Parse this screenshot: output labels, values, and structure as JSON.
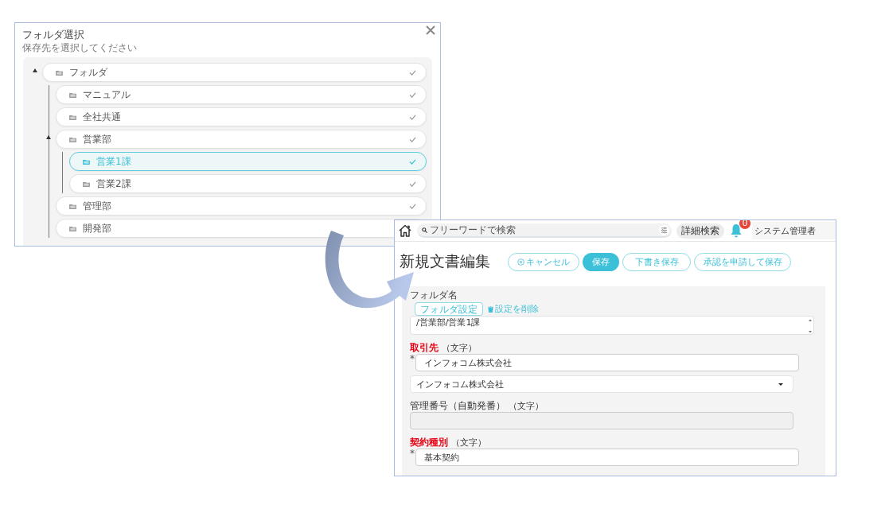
{
  "folder_dialog": {
    "title": "フォルダ選択",
    "subtitle": "保存先を選択してください",
    "tree": [
      {
        "label": "フォルダ",
        "selected": false,
        "children": [
          {
            "label": "マニュアル",
            "selected": false
          },
          {
            "label": "全社共通",
            "selected": false
          },
          {
            "label": "営業部",
            "selected": false,
            "children": [
              {
                "label": "営業1課",
                "selected": true
              },
              {
                "label": "営業2課",
                "selected": false
              }
            ]
          },
          {
            "label": "管理部",
            "selected": false
          },
          {
            "label": "開発部",
            "selected": false
          }
        ]
      }
    ]
  },
  "editor": {
    "header": {
      "search_placeholder": "フリーワードで検索",
      "advanced_search": "詳細検索",
      "notification_count": "0",
      "user": "システム管理者"
    },
    "title": "新規文書編集",
    "buttons": [
      {
        "label": "キャンセル",
        "kind": "cancel"
      },
      {
        "label": "保存",
        "kind": "primary"
      },
      {
        "label": "下書き保存",
        "kind": "outline"
      },
      {
        "label": "承認を申請して保存",
        "kind": "outline"
      }
    ],
    "folder": {
      "label": "フォルダ名",
      "set_button": "フォルダ設定",
      "clear_link": "設定を削除",
      "path": "/営業部/営業1課"
    },
    "fields": [
      {
        "kind": "label",
        "text": "取引先",
        "required": true,
        "note": "（文字）"
      },
      {
        "kind": "input",
        "value": "インフォコム株式会社",
        "mark": "*"
      },
      {
        "kind": "select",
        "value": "インフォコム株式会社"
      },
      {
        "kind": "label",
        "text": "管理番号（自動発番）",
        "required": false,
        "note": "（文字）"
      },
      {
        "kind": "readonly"
      },
      {
        "kind": "label",
        "text": "契約種別",
        "required": true,
        "note": "（文字）"
      },
      {
        "kind": "input",
        "value": "基本契約",
        "mark": "*"
      }
    ]
  }
}
